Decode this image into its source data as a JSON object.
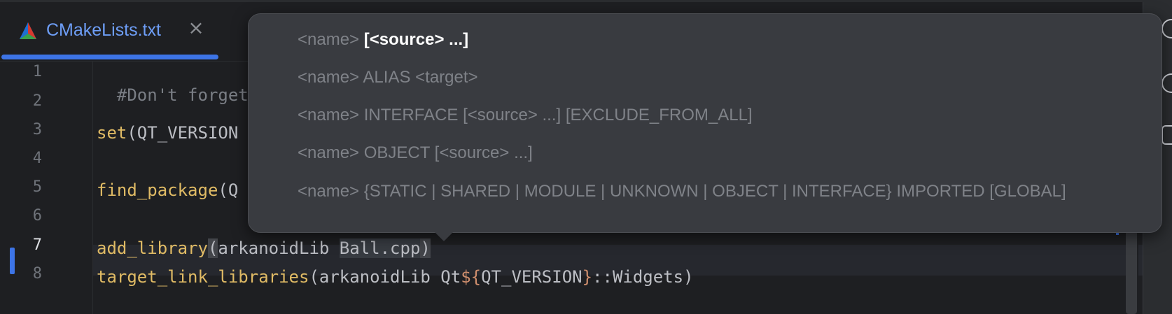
{
  "tab": {
    "filename": "CMakeLists.txt",
    "close_glyph": "×",
    "icon": "cmake-icon"
  },
  "gutter": {
    "line_numbers": [
      "1",
      "2",
      "3",
      "4",
      "5",
      "6",
      "7",
      "8"
    ],
    "current_line": "7"
  },
  "editor": {
    "line1": "#Don't forget",
    "line3_fn": "set",
    "line3_rest": "(QT_VERSION",
    "line5_fn": "find_package",
    "line5_rest": "(Q",
    "line7_fn": "add_library",
    "line7_open": "(",
    "line7_mid": "arkanoidLib ",
    "line7_arg": "Ball.cpp",
    "line7_close": ")",
    "line8_fn": "target_link_libraries",
    "line8_a": "(arkanoidLib Qt",
    "line8_var_open": "${",
    "line8_var": "QT_VERSION",
    "line8_var_close": "}",
    "line8_b": "::Widgets)"
  },
  "popup": {
    "signatures": [
      {
        "name": "<name>",
        "args": "[<source> ...]",
        "active": true
      },
      {
        "name": "<name>",
        "args": "ALIAS <target>",
        "active": false
      },
      {
        "name": "<name>",
        "args": "INTERFACE [<source> ...] [EXCLUDE_FROM_ALL]",
        "active": false
      },
      {
        "name": "<name>",
        "args": "OBJECT [<source> ...]",
        "active": false
      },
      {
        "name": "<name>",
        "args": "{STATIC | SHARED | MODULE | UNKNOWN | OBJECT | INTERFACE} IMPORTED [GLOBAL]",
        "active": false
      }
    ]
  },
  "colors": {
    "accent": "#3d74e6",
    "function": "#e0bb65",
    "comment": "#7a7e85",
    "variable_brace": "#cf8e6d",
    "background": "#1e1f22",
    "popup_bg": "#393b40"
  },
  "right_toolbar": {
    "icons": [
      "notifications-icon",
      "ai-assistant-icon",
      "database-icon"
    ]
  }
}
